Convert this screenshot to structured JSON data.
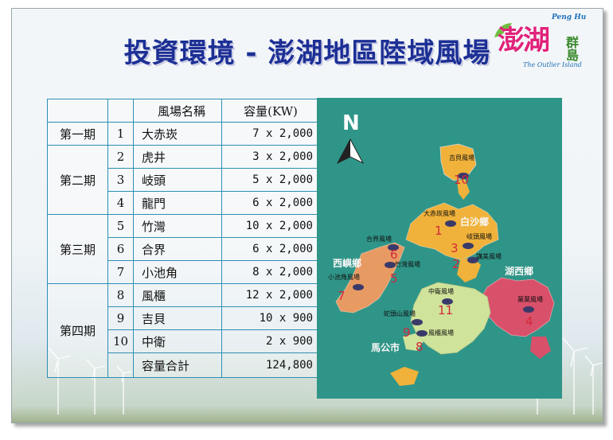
{
  "title": "投資環境 - 澎湖地區陸域風場",
  "logo": {
    "main": "澎湖",
    "small": "群島",
    "en_top": "Peng Hu",
    "en_bottom": "The Outlier Island"
  },
  "table": {
    "headers": {
      "name": "風場名稱",
      "capacity": "容量(KW)"
    },
    "phases": [
      {
        "label": "第一期",
        "rows": [
          {
            "no": "1",
            "name": "大赤崁",
            "capacity": "7 x 2,000"
          }
        ]
      },
      {
        "label": "第二期",
        "rows": [
          {
            "no": "2",
            "name": "虎井",
            "capacity": "3 x 2,000"
          },
          {
            "no": "3",
            "name": "岐頭",
            "capacity": "5 x 2,000"
          },
          {
            "no": "4",
            "name": "龍門",
            "capacity": "6 x 2,000"
          }
        ]
      },
      {
        "label": "第三期",
        "rows": [
          {
            "no": "5",
            "name": "竹灣",
            "capacity": "10 x 2,000"
          },
          {
            "no": "6",
            "name": "合界",
            "capacity": "6 x 2,000"
          },
          {
            "no": "7",
            "name": "小池角",
            "capacity": "8 x 2,000"
          }
        ]
      },
      {
        "label": "第四期",
        "rows": [
          {
            "no": "8",
            "name": "風櫃",
            "capacity": "12 x 2,000"
          },
          {
            "no": "9",
            "name": "吉貝",
            "capacity": "10 x 900"
          },
          {
            "no": "10",
            "name": "中衛",
            "capacity": "2 x 900"
          }
        ]
      }
    ],
    "total": {
      "label": "容量合計",
      "value": "124,800"
    }
  },
  "map": {
    "north": "N",
    "regions": {
      "baisha": "白沙鄉",
      "xiyu": "西嶼鄉",
      "huxi": "湖西鄉",
      "magong": "馬公市"
    },
    "sites": [
      {
        "no": "10",
        "name": "吉貝風場"
      },
      {
        "no": "1",
        "name": "大赤崁風場"
      },
      {
        "no": "3",
        "name": "岐頭風場"
      },
      {
        "no": "2",
        "name": "講美風場"
      },
      {
        "no": "6",
        "name": "合界風場"
      },
      {
        "no": "5",
        "name": "竹灣風場"
      },
      {
        "no": "7",
        "name": "小池角風場"
      },
      {
        "no": "11",
        "name": "中衛風場"
      },
      {
        "no": "4",
        "name": "菓葉風場"
      },
      {
        "no": "9",
        "name": "蛇頭山風場"
      },
      {
        "no": "8",
        "name": "風櫃風場"
      }
    ],
    "colors": {
      "sea": "#2f9588",
      "baisha": "#f0b23a",
      "xiyu": "#e89a63",
      "huxi": "#d9506a",
      "magong": "#cfe39a",
      "marker": "#d2283a"
    }
  }
}
